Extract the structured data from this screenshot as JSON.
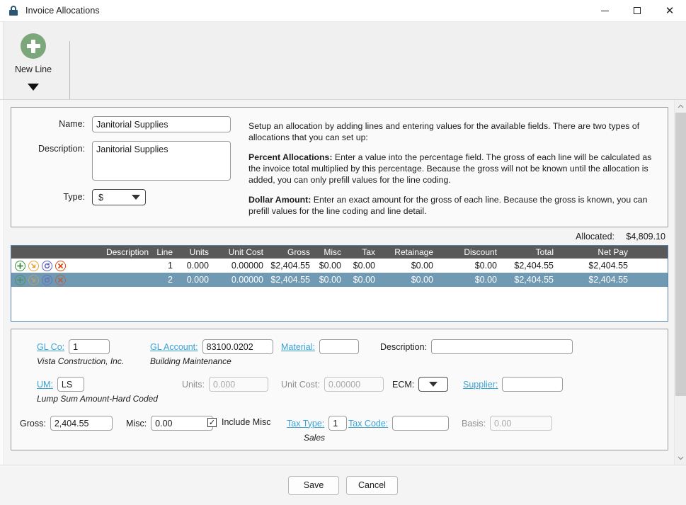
{
  "window": {
    "title": "Invoice Allocations",
    "icon": "lock-icon",
    "controls": {
      "minimize": "—",
      "maximize": "□",
      "close": "✕"
    }
  },
  "ribbon": {
    "new_line_label": "New Line",
    "new_line_icon": "plus-circle-icon",
    "overflow_icon": "caret-down-icon"
  },
  "setup": {
    "name_label": "Name:",
    "name_value": "Janitorial Supplies",
    "description_label": "Description:",
    "description_value": "Janitorial Supplies",
    "type_label": "Type:",
    "type_value": "$",
    "help": {
      "intro": "Setup an allocation by adding lines and entering values for the available fields. There are two types of allocations that you can set up:",
      "percent_title": "Percent Allocations:",
      "percent_body": "Enter a value into the percentage field. The gross of each line will be calculated as the invoice total multiplied by this percentage. Because the gross will not be known until the allocation is added, you can only prefill values for the line coding.",
      "dollar_title": "Dollar Amount:",
      "dollar_body": "Enter an exact amount for the gross of each line. Because the gross is known, you can prefill values for the line coding and line detail."
    }
  },
  "allocated": {
    "label": "Allocated:",
    "value": "$4,809.10"
  },
  "grid": {
    "columns": [
      "Description",
      "Line",
      "Units",
      "Unit Cost",
      "Gross",
      "Misc",
      "Tax",
      "Retainage",
      "Discount",
      "Total",
      "Net Pay"
    ],
    "row_icons": [
      "add-icon",
      "drill-down-icon",
      "refresh-icon",
      "delete-icon"
    ],
    "rows": [
      {
        "description": "",
        "line": "1",
        "units": "0.000",
        "unit_cost": "0.00000",
        "gross": "$2,404.55",
        "misc": "$0.00",
        "tax": "$0.00",
        "retainage": "$0.00",
        "discount": "$0.00",
        "total": "$2,404.55",
        "net_pay": "$2,404.55",
        "selected": false
      },
      {
        "description": "",
        "line": "2",
        "units": "0.000",
        "unit_cost": "0.00000",
        "gross": "$2,404.55",
        "misc": "$0.00",
        "tax": "$0.00",
        "retainage": "$0.00",
        "discount": "$0.00",
        "total": "$2,404.55",
        "net_pay": "$2,404.55",
        "selected": true
      }
    ]
  },
  "detail": {
    "gl_co_label": "GL Co:",
    "gl_co_value": "1",
    "gl_co_sub": "Vista Construction, Inc.",
    "gl_account_label": "GL Account:",
    "gl_account_value": "83100.0202",
    "gl_account_sub": "Building Maintenance",
    "material_label": "Material:",
    "material_value": "",
    "description_label": "Description:",
    "description_value": "",
    "um_label": "UM:",
    "um_value": "LS",
    "um_sub": "Lump Sum Amount-Hard Coded",
    "units_label": "Units:",
    "units_value": "0.000",
    "unit_cost_label": "Unit Cost:",
    "unit_cost_value": "0.00000",
    "ecm_label": "ECM:",
    "ecm_value": "",
    "supplier_label": "Supplier:",
    "supplier_value": "",
    "gross_label": "Gross:",
    "gross_value": "2,404.55",
    "misc_label": "Misc:",
    "misc_value": "0.00",
    "include_misc_label": "Include Misc",
    "include_misc_checked": "✓",
    "tax_type_label": "Tax Type:",
    "tax_type_value": "1",
    "tax_type_sub": "Sales",
    "tax_code_label": "Tax Code:",
    "tax_code_value": "",
    "basis_label": "Basis:",
    "basis_value": "0.00"
  },
  "footer": {
    "save_label": "Save",
    "cancel_label": "Cancel"
  },
  "scrollbar": {
    "up_icon": "chevron-up-icon",
    "down_icon": "chevron-down-icon"
  },
  "colors": {
    "accent_green": "#7ca77a",
    "grid_header": "#595959",
    "selection": "#7099b3",
    "link": "#3aa3d6"
  }
}
